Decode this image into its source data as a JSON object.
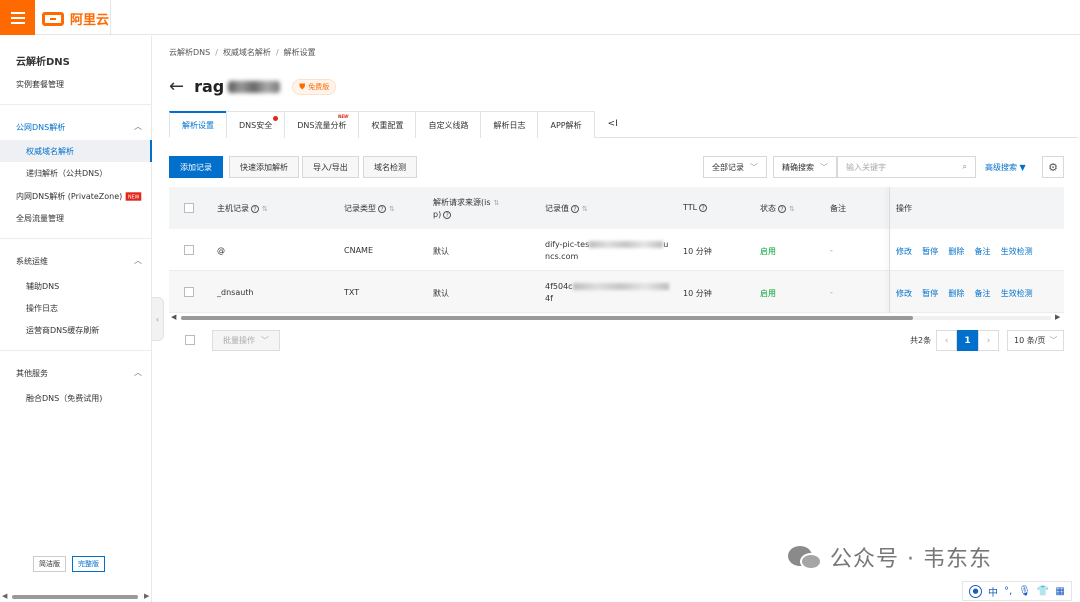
{
  "brand": {
    "logo_text": "阿里云",
    "accent": "#ff6a00",
    "primary": "#0070cc"
  },
  "sidebar": {
    "title": "云解析DNS",
    "instance": "实例套餐管理",
    "group_public": "公网DNS解析",
    "item_authoritative": "权威域名解析",
    "item_recursive": "递归解析（公共DNS）",
    "item_private": "内网DNS解析 (PrivateZone)",
    "new_badge": "NEW",
    "item_traffic": "全局流量管理",
    "group_ops": "系统运维",
    "item_assist": "辅助DNS",
    "item_oplog": "操作日志",
    "item_cache": "运营商DNS缓存刷新",
    "group_other": "其他服务",
    "item_fusion": "融合DNS（免费试用)",
    "ver_simple": "简洁版",
    "ver_full": "完整版"
  },
  "breadcrumb": {
    "a": "云解析DNS",
    "b": "权威域名解析",
    "c": "解析设置",
    "sep": "/"
  },
  "header": {
    "domain_prefix": "rag",
    "badge": "免费版"
  },
  "tabs": [
    {
      "label": "解析设置"
    },
    {
      "label": "DNS安全"
    },
    {
      "label": "DNS流量分析"
    },
    {
      "label": "权重配置"
    },
    {
      "label": "自定义线路"
    },
    {
      "label": "解析日志"
    },
    {
      "label": "APP解析"
    }
  ],
  "tab_new": "NEW",
  "tab_more": "<I",
  "toolbar": {
    "add": "添加记录",
    "quick_add": "快速添加解析",
    "import_export": "导入/导出",
    "domain_check": "域名检测",
    "filter_all": "全部记录",
    "search_mode": "精确搜索",
    "search_placeholder": "输入关键字",
    "advanced": "高级搜索"
  },
  "table": {
    "headers": {
      "host": "主机记录",
      "type": "记录类型",
      "source_a": "解析请求来源(",
      "source_b": "p)",
      "source_mid": "is",
      "value": "记录值",
      "ttl": "TTL",
      "status": "状态",
      "remark": "备注",
      "ops": "操作"
    },
    "rows": [
      {
        "host": "@",
        "type": "CNAME",
        "source": "默认",
        "value_a": "dify-pic-tes",
        "value_a_end": "u",
        "value_b": "ncs.com",
        "ttl": "10 分钟",
        "status": "启用",
        "remark": "-"
      },
      {
        "host": "_dnsauth",
        "type": "TXT",
        "source": "默认",
        "value_a": "4f504c",
        "value_a_end": "",
        "value_b": "4f",
        "ttl": "10 分钟",
        "status": "启用",
        "remark": "-"
      }
    ],
    "ops": {
      "edit": "修改",
      "pause": "暂停",
      "delete": "删除",
      "note": "备注",
      "verify": "生效检测"
    }
  },
  "footer": {
    "batch": "批量操作",
    "total": "共2条",
    "page": "1",
    "page_size": "10 条/页"
  },
  "watermark": {
    "text": "公众号 · 韦东东"
  },
  "ime": {
    "lang": "中",
    "punct": "°,"
  }
}
